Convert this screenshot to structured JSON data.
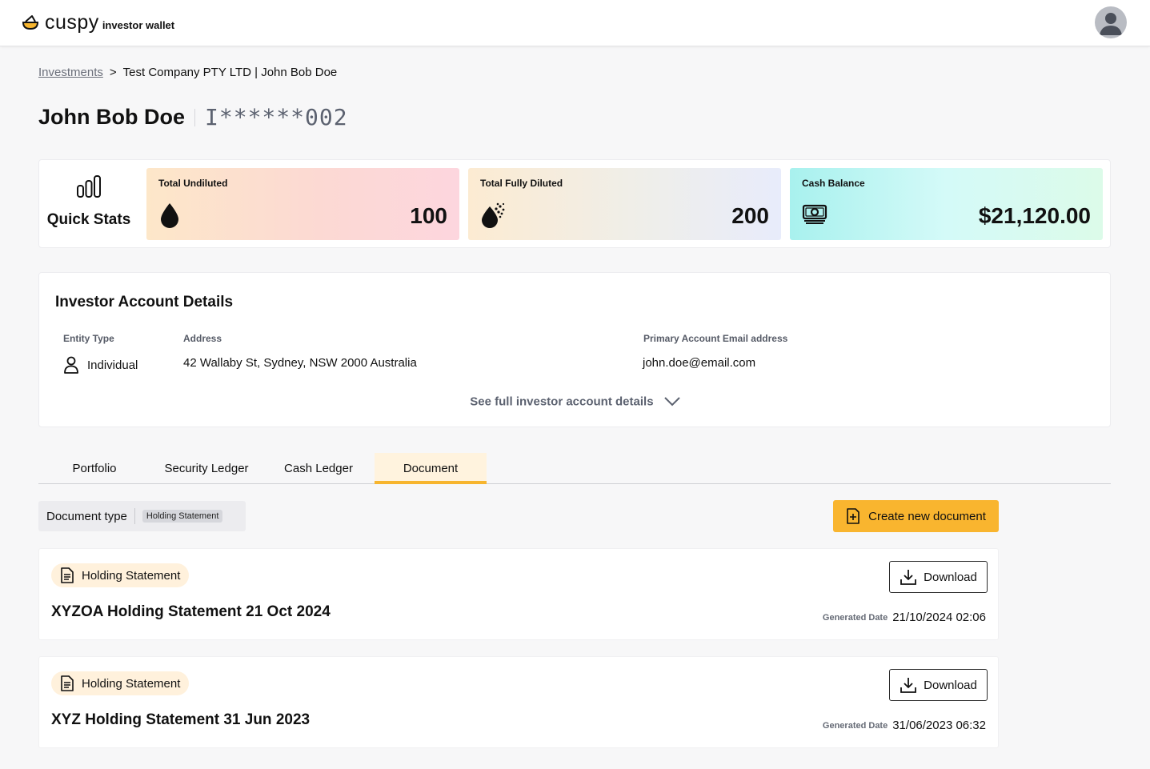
{
  "app": {
    "brand": "cuspy",
    "brand_sub": "investor wallet"
  },
  "breadcrumb": {
    "root": "Investments",
    "separator": ">",
    "current": "Test Company PTY LTD | John Bob Doe"
  },
  "investor": {
    "name": "John Bob Doe",
    "account_masked": "I******002"
  },
  "quick_stats": {
    "label": "Quick Stats",
    "cards": [
      {
        "title": "Total Undiluted",
        "value": "100",
        "icon": "droplet-icon"
      },
      {
        "title": "Total Fully Diluted",
        "value": "200",
        "icon": "diluted-droplet-icon"
      },
      {
        "title": "Cash Balance",
        "value": "$21,120.00",
        "icon": "cash-icon"
      }
    ]
  },
  "account_details": {
    "heading": "Investor Account Details",
    "entity_type_label": "Entity Type",
    "entity_type_value": "Individual",
    "address_label": "Address",
    "address_value": "42 Wallaby St, Sydney, NSW 2000 Australia",
    "email_label": "Primary Account Email address",
    "email_value": "john.doe@email.com",
    "see_more": "See full investor account details"
  },
  "tabs": [
    {
      "label": "Portfolio",
      "active": false
    },
    {
      "label": "Security Ledger",
      "active": false
    },
    {
      "label": "Cash Ledger",
      "active": false
    },
    {
      "label": "Document",
      "active": true
    }
  ],
  "filter": {
    "label": "Document type",
    "selected": "Holding Statement"
  },
  "create_button": "Create new document",
  "documents": [
    {
      "type": "Holding Statement",
      "title": "XYZOA Holding Statement 21 Oct 2024",
      "download_label": "Download",
      "generated_label": "Generated Date",
      "generated_value": "21/10/2024 02:06"
    },
    {
      "type": "Holding Statement",
      "title": "XYZ Holding Statement 31 Jun 2023",
      "download_label": "Download",
      "generated_label": "Generated Date",
      "generated_value": "31/06/2023 06:32"
    }
  ],
  "colors": {
    "accent": "#f9b52f",
    "tab_active_bg": "#fff3de",
    "tag_bg": "#fff1dc"
  }
}
